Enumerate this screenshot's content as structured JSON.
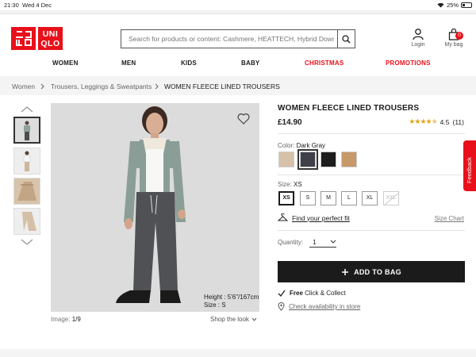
{
  "status_bar": {
    "time": "21:30",
    "date": "Wed 4 Dec",
    "battery": "25%"
  },
  "header": {
    "logo_lines": [
      "UNI",
      "QLO"
    ],
    "search_placeholder": "Search for products or content: Cashmere, HEATTECH, Hybrid Down...",
    "login_label": "Login",
    "bag_label": "My bag",
    "bag_count": "0"
  },
  "nav": [
    {
      "label": "WOMEN",
      "highlight": false
    },
    {
      "label": "MEN",
      "highlight": false
    },
    {
      "label": "KIDS",
      "highlight": false
    },
    {
      "label": "BABY",
      "highlight": false
    },
    {
      "label": "CHRISTMAS",
      "highlight": true
    },
    {
      "label": "PROMOTIONS",
      "highlight": true
    }
  ],
  "breadcrumb": [
    "Women",
    "Trousers, Leggings & Sweatpants",
    "WOMEN FLEECE LINED TROUSERS"
  ],
  "gallery": {
    "model_height": "Height : 5'6\"/167cm",
    "model_size": "Size : S",
    "image_counter_label": "Image:",
    "image_counter": "1/9",
    "shop_the_look": "Shop the look"
  },
  "product": {
    "title": "WOMEN FLEECE LINED TROUSERS",
    "price": "£14.90",
    "rating_value": "4.5",
    "rating_count": "(11)",
    "rating_stars": 4.5,
    "color_label": "Color:",
    "color_selected": "Dark Gray",
    "colors": [
      "#d6c1a9",
      "#3e4149",
      "#1d1d1d",
      "#c6986a"
    ],
    "size_label": "Size:",
    "size_selected": "XS",
    "sizes": [
      "XS",
      "S",
      "M",
      "L",
      "XL",
      "XXL"
    ],
    "fit_link": "Find your perfect fit",
    "size_chart": "Size Chart",
    "quantity_label": "Quantity:",
    "quantity": "1",
    "add_to_bag": "ADD TO BAG",
    "free_label": "Free",
    "click_collect": "Click & Collect",
    "availability": "Check availability in store"
  },
  "feedback_tab": "Feedback",
  "accent": "#e8101a"
}
